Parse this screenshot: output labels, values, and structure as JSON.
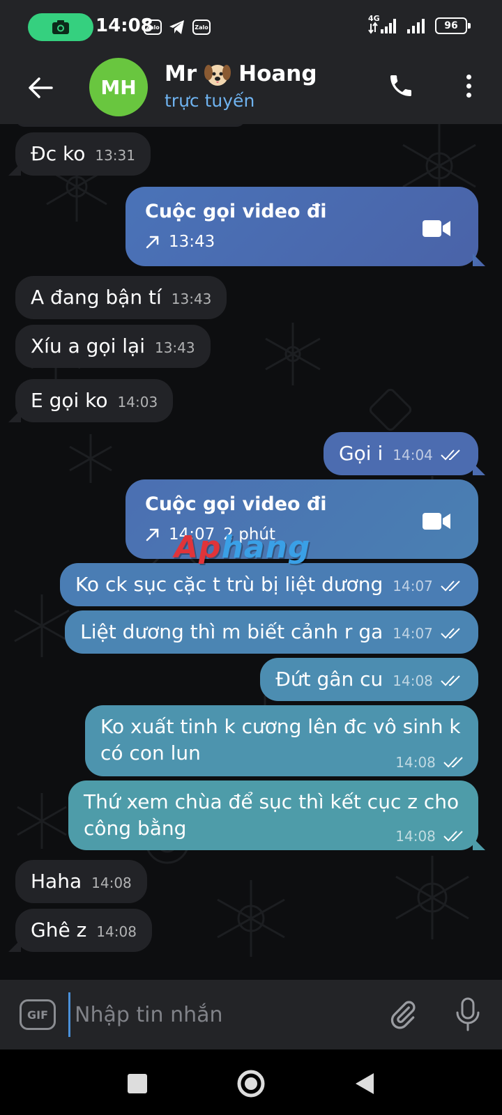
{
  "status_bar": {
    "time": "14:08",
    "zalo_label": "Zalo",
    "network": "4G",
    "battery": "96"
  },
  "header": {
    "contact_name_prefix": "Mr",
    "contact_name_suffix": "Hoang",
    "avatar_initials": "MH",
    "status": "trực tuyến"
  },
  "messages": [
    {
      "dir": "in",
      "text": "Đc ko",
      "time": "13:31"
    },
    {
      "dir": "out_call",
      "title": "Cuộc gọi video đi",
      "time": "13:43"
    },
    {
      "dir": "in",
      "text": "A đang bận tí",
      "time": "13:43"
    },
    {
      "dir": "in",
      "text": "Xíu a gọi lại",
      "time": "13:43"
    },
    {
      "dir": "in",
      "text": "E gọi ko",
      "time": "14:03"
    },
    {
      "dir": "out",
      "text": "Gọi i",
      "time": "14:04"
    },
    {
      "dir": "out_call",
      "title": "Cuộc gọi video đi",
      "time": "14:07",
      "duration": "2 phút"
    },
    {
      "dir": "out",
      "text": "Ko ck sục cặc t trù bị liệt dương",
      "time": "14:07"
    },
    {
      "dir": "out",
      "text": "Liệt dương thì m biết cảnh r ga",
      "time": "14:07"
    },
    {
      "dir": "out",
      "text": "Đứt gân cu",
      "time": "14:08"
    },
    {
      "dir": "out",
      "text": "Ko xuất tinh k cương lên đc vô sinh k có con lun",
      "time": "14:08"
    },
    {
      "dir": "out",
      "text": "Thứ xem chùa để sục thì kết cục z cho công bằng",
      "time": "14:08"
    },
    {
      "dir": "in",
      "text": "Haha",
      "time": "14:08"
    },
    {
      "dir": "in",
      "text": "Ghê z",
      "time": "14:08"
    }
  ],
  "watermark": {
    "part1": "Ap",
    "part2": "hang"
  },
  "composer": {
    "gif_label": "GIF",
    "placeholder": "Nhập tin nhắn"
  },
  "colors": {
    "header_bg": "#232427",
    "incoming_bubble": "#222327",
    "outgoing_top": "#4a6fb5",
    "outgoing_bottom": "#4fa0a8",
    "online_status": "#6fb3f0",
    "avatar_bg": "#69c63f"
  }
}
